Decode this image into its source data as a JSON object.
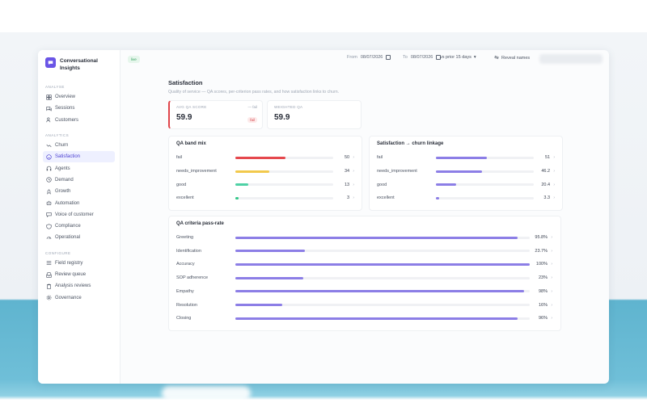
{
  "sidebar": {
    "brand": "Conversational Insights",
    "brand_icon": "chat-bubble-icon",
    "sections": [
      {
        "label": "ANALYSE",
        "items": [
          {
            "label": "Overview",
            "icon": "grid-icon"
          },
          {
            "label": "Sessions",
            "icon": "chat-icon"
          },
          {
            "label": "Customers",
            "icon": "users-icon"
          }
        ]
      },
      {
        "label": "ANALYTICS",
        "items": [
          {
            "label": "Churn",
            "icon": "trend-down-icon"
          },
          {
            "label": "Satisfaction",
            "icon": "smile-icon",
            "active": true
          },
          {
            "label": "Agents",
            "icon": "headset-icon"
          },
          {
            "label": "Demand",
            "icon": "clock-icon"
          },
          {
            "label": "Growth",
            "icon": "rocket-icon"
          },
          {
            "label": "Automation",
            "icon": "bot-icon"
          },
          {
            "label": "Voice of customer",
            "icon": "speech-icon"
          },
          {
            "label": "Compliance",
            "icon": "shield-icon"
          },
          {
            "label": "Operational",
            "icon": "gauge-icon"
          }
        ]
      },
      {
        "label": "CONFIGURE",
        "items": [
          {
            "label": "Field registry",
            "icon": "list-icon"
          },
          {
            "label": "Review queue",
            "icon": "inbox-icon"
          },
          {
            "label": "Analysis reviews",
            "icon": "clipboard-icon"
          },
          {
            "label": "Governance",
            "icon": "gear-icon"
          }
        ]
      }
    ]
  },
  "topbar": {
    "badge": "live",
    "from_label": "From",
    "from_date": "08/07/2026",
    "to_label": "To",
    "to_date": "08/07/2026",
    "compare": "vs prior 15 days",
    "reveal": "Reveal names"
  },
  "page": {
    "title": "Satisfaction",
    "subtitle": "Quality of service — QA scores, per-criterion pass rates, and how satisfaction links to churn."
  },
  "kpis": [
    {
      "label": "AVG QA SCORE",
      "value": "59.9",
      "target": "— fail",
      "pill": "fail"
    },
    {
      "label": "WEIGHTED QA",
      "value": "59.9"
    }
  ],
  "qa_band_mix": {
    "title": "QA band mix",
    "rows": [
      {
        "label": "fail",
        "value": "50",
        "fraction": 0.5,
        "color": "#e5484d"
      },
      {
        "label": "needs_improvement",
        "value": "34",
        "fraction": 0.34,
        "color": "#f2c94c"
      },
      {
        "label": "good",
        "value": "13",
        "fraction": 0.13,
        "color": "#4fd1a5"
      },
      {
        "label": "excellent",
        "value": "3",
        "fraction": 0.03,
        "color": "#34c789"
      }
    ]
  },
  "churn_linkage": {
    "title": "Satisfaction → churn linkage",
    "rows": [
      {
        "label": "fail",
        "value": "51",
        "fraction": 0.51
      },
      {
        "label": "needs_improvement",
        "value": "46.2",
        "fraction": 0.462
      },
      {
        "label": "good",
        "value": "20.4",
        "fraction": 0.204
      },
      {
        "label": "excellent",
        "value": "3.3",
        "fraction": 0.033
      }
    ],
    "color": "#8c7ee6"
  },
  "criteria": {
    "title": "QA criteria pass-rate",
    "color": "#8c7ee6",
    "rows": [
      {
        "label": "Greeting",
        "value": "95.8%",
        "fraction": 0.958
      },
      {
        "label": "Identification",
        "value": "23.7%",
        "fraction": 0.237
      },
      {
        "label": "Accuracy",
        "value": "100%",
        "fraction": 1.0
      },
      {
        "label": "SOP adherence",
        "value": "23%",
        "fraction": 0.23
      },
      {
        "label": "Empathy",
        "value": "98%",
        "fraction": 0.98
      },
      {
        "label": "Resolution",
        "value": "16%",
        "fraction": 0.16
      },
      {
        "label": "Closing",
        "value": "96%",
        "fraction": 0.96
      }
    ]
  }
}
